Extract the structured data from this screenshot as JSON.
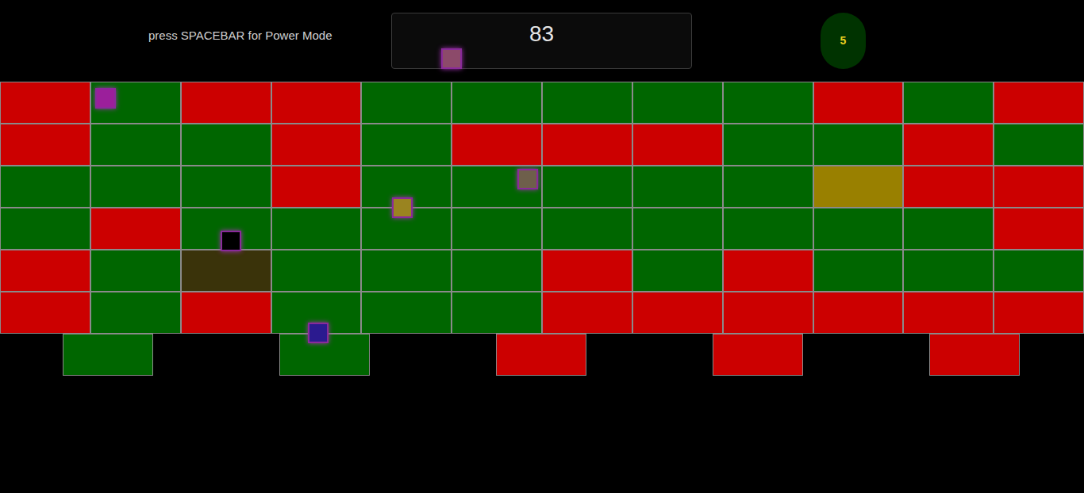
{
  "hud": {
    "hint": "press SPACEBAR for Power Mode",
    "score": "83",
    "lives": "5"
  },
  "grid": {
    "rows": [
      [
        {
          "color": "#cc0000"
        },
        {
          "color": "#006600"
        },
        {
          "color": "#cc0000"
        },
        {
          "color": "#cc0000"
        },
        {
          "color": "#006600"
        },
        {
          "color": "#006600"
        },
        {
          "color": "#006600"
        },
        {
          "color": "#006600"
        },
        {
          "color": "#006600"
        },
        {
          "color": "#cc0000"
        },
        {
          "color": "#006600"
        },
        {
          "color": "#cc0000"
        }
      ],
      [
        {
          "color": "#cc0000"
        },
        {
          "color": "#006600"
        },
        {
          "color": "#006600"
        },
        {
          "color": "#cc0000"
        },
        {
          "color": "#006600"
        },
        {
          "color": "#cc0000"
        },
        {
          "color": "#cc0000"
        },
        {
          "color": "#cc0000"
        },
        {
          "color": "#006600"
        },
        {
          "color": "#006600"
        },
        {
          "color": "#cc0000"
        },
        {
          "color": "#006600"
        }
      ],
      [
        {
          "color": "#006600"
        },
        {
          "color": "#006600"
        },
        {
          "color": "#006600"
        },
        {
          "color": "#cc0000"
        },
        {
          "color": "#006600"
        },
        {
          "color": "#006600"
        },
        {
          "color": "#006600"
        },
        {
          "color": "#006600"
        },
        {
          "color": "#006600"
        },
        {
          "color": "#998000"
        },
        {
          "color": "#cc0000"
        },
        {
          "color": "#cc0000"
        }
      ],
      [
        {
          "color": "#006600"
        },
        {
          "color": "#cc0000"
        },
        {
          "color": "#006600"
        },
        {
          "color": "#006600"
        },
        {
          "color": "#006600"
        },
        {
          "color": "#006600"
        },
        {
          "color": "#006600"
        },
        {
          "color": "#006600"
        },
        {
          "color": "#006600"
        },
        {
          "color": "#006600"
        },
        {
          "color": "#006600"
        },
        {
          "color": "#cc0000"
        }
      ],
      [
        {
          "color": "#cc0000"
        },
        {
          "color": "#006600"
        },
        {
          "color": "#3a330a"
        },
        {
          "color": "#006600"
        },
        {
          "color": "#006600"
        },
        {
          "color": "#006600"
        },
        {
          "color": "#cc0000"
        },
        {
          "color": "#006600"
        },
        {
          "color": "#cc0000"
        },
        {
          "color": "#006600"
        },
        {
          "color": "#006600"
        },
        {
          "color": "#006600"
        }
      ],
      [
        {
          "color": "#cc0000"
        },
        {
          "color": "#006600"
        },
        {
          "color": "#cc0000"
        },
        {
          "color": "#006600"
        },
        {
          "color": "#006600"
        },
        {
          "color": "#006600"
        },
        {
          "color": "#cc0000"
        },
        {
          "color": "#cc0000"
        },
        {
          "color": "#cc0000"
        },
        {
          "color": "#cc0000"
        },
        {
          "color": "#cc0000"
        },
        {
          "color": "#cc0000"
        }
      ]
    ]
  },
  "pads": [
    {
      "color": "#006600"
    },
    {
      "color": "#006600"
    },
    {
      "color": "#cc0000"
    },
    {
      "color": "#cc0000"
    },
    {
      "color": "#cc0000"
    }
  ],
  "pieces": [
    {
      "color": "#9b1f9b"
    },
    {
      "color": "#9a8420"
    },
    {
      "color": "#6e5f4b"
    },
    {
      "color": "#000000"
    },
    {
      "color": "#2b1a8f"
    },
    {
      "color": "#8c4a6a"
    }
  ]
}
